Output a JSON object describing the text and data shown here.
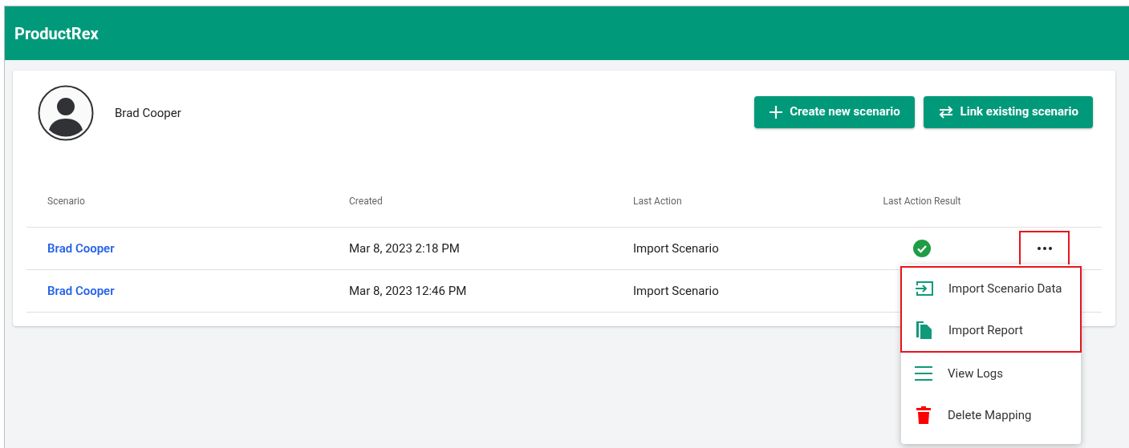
{
  "app_bar": {
    "title": "ProductRex"
  },
  "profile": {
    "name": "Brad Cooper"
  },
  "actions": [
    {
      "label": "Create new scenario",
      "kind": "create"
    },
    {
      "label": "Link existing scenario",
      "kind": "link"
    }
  ],
  "table": {
    "columns": [
      "Scenario",
      "Created",
      "Last Action",
      "Last Action Result"
    ],
    "rows": [
      {
        "scenario": "Brad Cooper",
        "created": "Mar 8, 2023 2:18 PM",
        "last_action": "Import Scenario",
        "kind": "success",
        "more_button": {
          "highlighted": true
        }
      },
      {
        "scenario": "Brad Cooper",
        "created": "Mar 8, 2023 12:46 PM",
        "last_action": "Import Scenario",
        "kind": "covered"
      }
    ]
  },
  "menu": {
    "groups": [
      {
        "highlighted": true,
        "items": [
          {
            "label": "Import Scenario Data",
            "kind": "import"
          },
          {
            "label": "Import Report",
            "kind": "report"
          }
        ]
      },
      {
        "highlighted": false,
        "items": [
          {
            "label": "View Logs",
            "kind": "logs"
          },
          {
            "label": "Delete Mapping",
            "kind": "delete"
          }
        ]
      }
    ]
  }
}
